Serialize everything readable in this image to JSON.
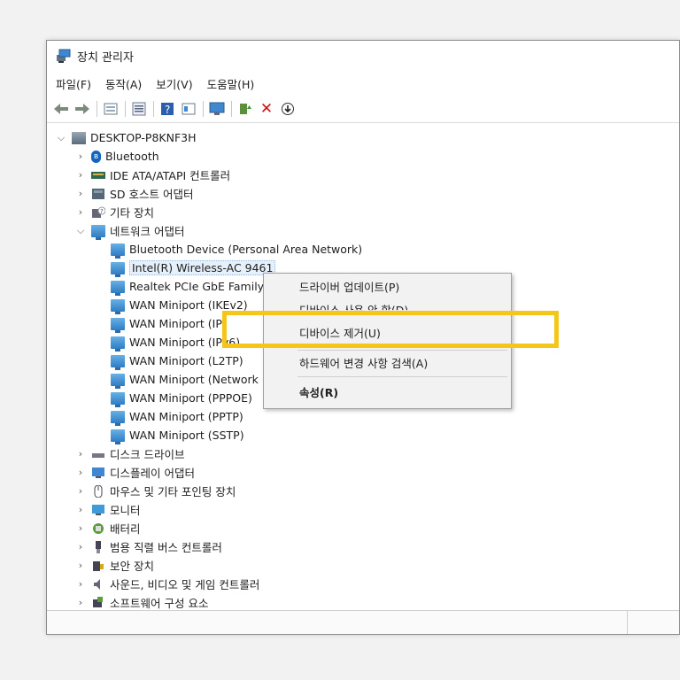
{
  "window": {
    "title": "장치 관리자",
    "menu": [
      "파일(F)",
      "동작(A)",
      "보기(V)",
      "도움말(H)"
    ]
  },
  "toolbar": {
    "icons": [
      "back-arrow-icon",
      "forward-arrow-icon",
      "show-hidden-icon",
      "properties-icon",
      "help-icon",
      "view-icon",
      "monitor-icon",
      "update-driver-icon",
      "uninstall-icon",
      "download-icon"
    ],
    "uninstall_color": "#d01010"
  },
  "tree": {
    "root": "DESKTOP-P8KNF3H",
    "categories_before": [
      "Bluetooth",
      "IDE ATA/ATAPI 컨트롤러",
      "SD 호스트 어댑터",
      "기타 장치"
    ],
    "network_category": "네트워크 어댑터",
    "network_devices": [
      "Bluetooth Device (Personal Area Network)",
      "Intel(R) Wireless-AC 9461",
      "Realtek PCIe GbE Family",
      "WAN Miniport (IKEv2)",
      "WAN Miniport (IP)",
      "WAN Miniport (IPv6)",
      "WAN Miniport (L2TP)",
      "WAN Miniport (Network Monitor)",
      "WAN Miniport (PPPOE)",
      "WAN Miniport (PPTP)",
      "WAN Miniport (SSTP)"
    ],
    "categories_after": [
      "디스크 드라이브",
      "디스플레이 어댑터",
      "마우스 및 기타 포인팅 장치",
      "모니터",
      "배터리",
      "범용 직렬 버스 컨트롤러",
      "보안 장치",
      "사운드, 비디오 및 게임 컨트롤러",
      "소프트웨어 구성 요소"
    ]
  },
  "context_menu": {
    "update_driver": "드라이버 업데이트(P)",
    "disable_device": "디바이스 사용 안 함(D)",
    "uninstall_device": "디바이스 제거(U)",
    "scan_hardware": "하드웨어 변경 사항 검색(A)",
    "properties": "속성(R)"
  },
  "colors": {
    "highlight": "#f5c518",
    "selection": "#e6f0fb"
  }
}
